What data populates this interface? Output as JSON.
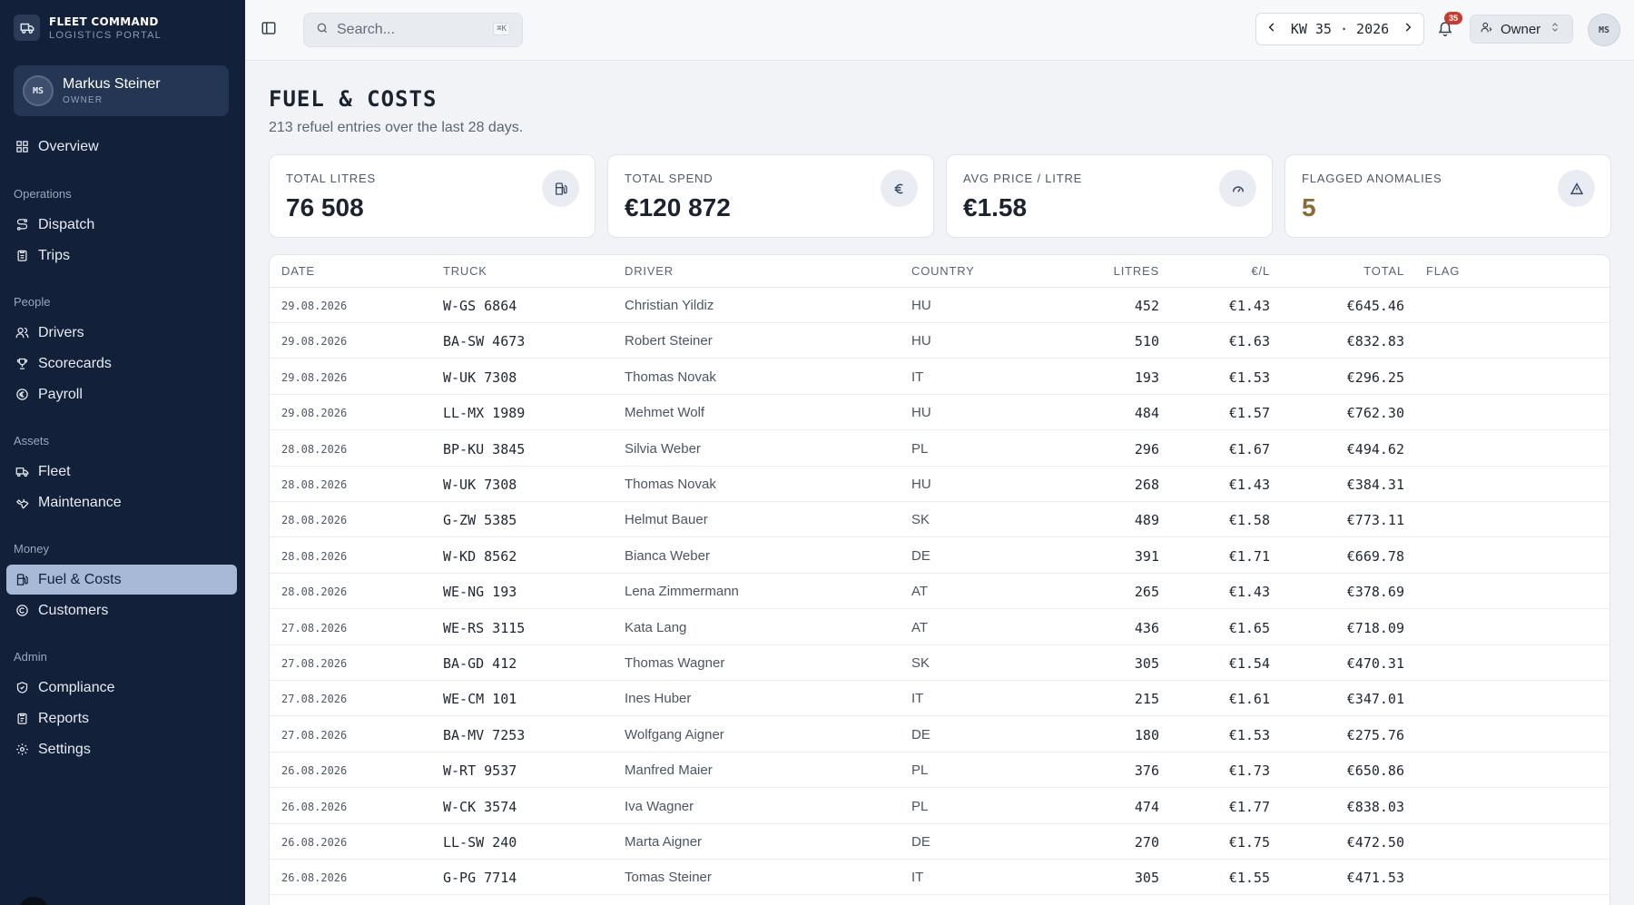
{
  "brand": {
    "name": "FLEET COMMAND",
    "subtitle": "LOGISTICS PORTAL"
  },
  "user": {
    "initials": "MS",
    "name": "Markus Steiner",
    "role": "OWNER"
  },
  "nav": {
    "overview": "Overview",
    "sections": {
      "operations": "Operations",
      "people": "People",
      "assets": "Assets",
      "money": "Money",
      "admin": "Admin"
    },
    "dispatch": "Dispatch",
    "trips": "Trips",
    "drivers": "Drivers",
    "scorecards": "Scorecards",
    "payroll": "Payroll",
    "fleet": "Fleet",
    "maintenance": "Maintenance",
    "fuel_costs": "Fuel & Costs",
    "customers": "Customers",
    "compliance": "Compliance",
    "reports": "Reports",
    "settings": "Settings"
  },
  "topbar": {
    "search_placeholder": "Search...",
    "search_shortcut": "⌘K",
    "week_label": "KW 35 · 2026",
    "notifications_count": "35",
    "role_label": "Owner",
    "avatar_initials": "MS"
  },
  "page": {
    "title": "FUEL & COSTS",
    "subtitle": "213 refuel entries over the last 28 days."
  },
  "kpis": [
    {
      "label": "TOTAL LITRES",
      "value": "76 508",
      "icon": "fuel-pump-icon"
    },
    {
      "label": "TOTAL SPEND",
      "value": "€120 872",
      "icon": "euro-icon"
    },
    {
      "label": "AVG PRICE / LITRE",
      "value": "€1.58",
      "icon": "gauge-icon"
    },
    {
      "label": "FLAGGED ANOMALIES",
      "value": "5",
      "icon": "warning-triangle-icon"
    }
  ],
  "table": {
    "columns": [
      "DATE",
      "TRUCK",
      "DRIVER",
      "COUNTRY",
      "LITRES",
      "€/L",
      "TOTAL",
      "FLAG"
    ],
    "rows": [
      {
        "date": "29.08.2026",
        "truck": "W-GS 6864",
        "driver": "Christian Yildiz",
        "country": "HU",
        "litres": "452",
        "price": "€1.43",
        "total": "€645.46"
      },
      {
        "date": "29.08.2026",
        "truck": "BA-SW 4673",
        "driver": "Robert Steiner",
        "country": "HU",
        "litres": "510",
        "price": "€1.63",
        "total": "€832.83"
      },
      {
        "date": "29.08.2026",
        "truck": "W-UK 7308",
        "driver": "Thomas Novak",
        "country": "IT",
        "litres": "193",
        "price": "€1.53",
        "total": "€296.25"
      },
      {
        "date": "29.08.2026",
        "truck": "LL-MX 1989",
        "driver": "Mehmet Wolf",
        "country": "HU",
        "litres": "484",
        "price": "€1.57",
        "total": "€762.30"
      },
      {
        "date": "28.08.2026",
        "truck": "BP-KU 3845",
        "driver": "Silvia Weber",
        "country": "PL",
        "litres": "296",
        "price": "€1.67",
        "total": "€494.62"
      },
      {
        "date": "28.08.2026",
        "truck": "W-UK 7308",
        "driver": "Thomas Novak",
        "country": "HU",
        "litres": "268",
        "price": "€1.43",
        "total": "€384.31"
      },
      {
        "date": "28.08.2026",
        "truck": "G-ZW 5385",
        "driver": "Helmut Bauer",
        "country": "SK",
        "litres": "489",
        "price": "€1.58",
        "total": "€773.11"
      },
      {
        "date": "28.08.2026",
        "truck": "W-KD 8562",
        "driver": "Bianca Weber",
        "country": "DE",
        "litres": "391",
        "price": "€1.71",
        "total": "€669.78"
      },
      {
        "date": "28.08.2026",
        "truck": "WE-NG 193",
        "driver": "Lena Zimmermann",
        "country": "AT",
        "litres": "265",
        "price": "€1.43",
        "total": "€378.69"
      },
      {
        "date": "27.08.2026",
        "truck": "WE-RS 3115",
        "driver": "Kata Lang",
        "country": "AT",
        "litres": "436",
        "price": "€1.65",
        "total": "€718.09"
      },
      {
        "date": "27.08.2026",
        "truck": "BA-GD 412",
        "driver": "Thomas Wagner",
        "country": "SK",
        "litres": "305",
        "price": "€1.54",
        "total": "€470.31"
      },
      {
        "date": "27.08.2026",
        "truck": "WE-CM 101",
        "driver": "Ines Huber",
        "country": "IT",
        "litres": "215",
        "price": "€1.61",
        "total": "€347.01"
      },
      {
        "date": "27.08.2026",
        "truck": "BA-MV 7253",
        "driver": "Wolfgang Aigner",
        "country": "DE",
        "litres": "180",
        "price": "€1.53",
        "total": "€275.76"
      },
      {
        "date": "26.08.2026",
        "truck": "W-RT 9537",
        "driver": "Manfred Maier",
        "country": "PL",
        "litres": "376",
        "price": "€1.73",
        "total": "€650.86"
      },
      {
        "date": "26.08.2026",
        "truck": "W-CK 3574",
        "driver": "Iva Wagner",
        "country": "PL",
        "litres": "474",
        "price": "€1.77",
        "total": "€838.03"
      },
      {
        "date": "26.08.2026",
        "truck": "LL-SW 240",
        "driver": "Marta Aigner",
        "country": "DE",
        "litres": "270",
        "price": "€1.75",
        "total": "€472.50"
      },
      {
        "date": "26.08.2026",
        "truck": "G-PG 7714",
        "driver": "Tomas Steiner",
        "country": "IT",
        "litres": "305",
        "price": "€1.55",
        "total": "€471.53"
      }
    ]
  },
  "colors": {
    "sidebar_bg": "#132039",
    "active_nav_bg": "#a7b9d6",
    "anomaly_value": "#8a6c34",
    "badge": "#c93a2f"
  }
}
